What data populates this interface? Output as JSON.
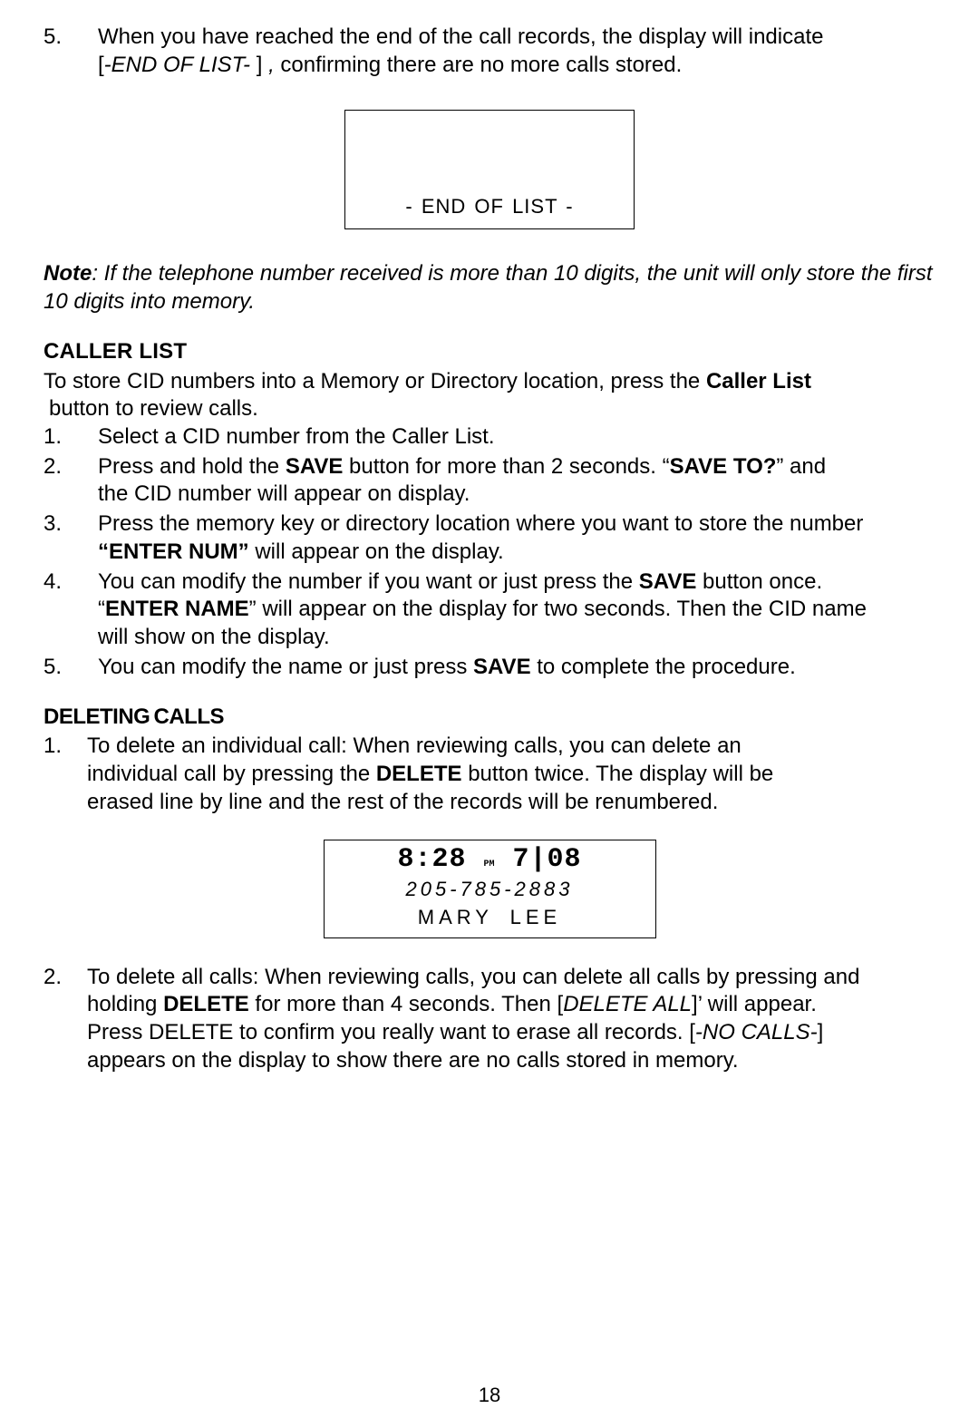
{
  "intro": {
    "num": "5.",
    "line1_a": "When you have reached the end of the call records, the display will indicate",
    "line2_b": "[",
    "line2_it": "-END OF LIST- ",
    "line2_c": "] ",
    "line2_d": ",",
    "line2_e": " confirming there are no more calls stored."
  },
  "endbox": "- END  OF  LIST -",
  "note": {
    "label": "Note",
    "text": ": If the telephone number received is more than 10 digits, the unit will only store the first 10 digits into memory."
  },
  "callerlist": {
    "heading": "CALLER LIST",
    "intro_a": "To store CID numbers into a Memory or Directory location, press the ",
    "intro_b": "Caller List",
    "intro_c": " button to review calls.",
    "items": {
      "i1": {
        "num": "1.",
        "a": "Select a CID number from the Caller List."
      },
      "i2": {
        "num": "2.",
        "a": "Press and hold the ",
        "b": "SAVE",
        "c": " button for more than 2 seconds. “",
        "d": "SAVE TO?",
        "e": "” and",
        "f": "the CID number will appear on display."
      },
      "i3": {
        "num": "3.",
        "a": "Press the memory key or directory location where you want to store the number",
        "b": "“ENTER NUM”",
        "c": " will appear on the display."
      },
      "i4": {
        "num": "4.",
        "a": "You can modify the number if you want or just press the ",
        "b": "SAVE",
        "c": " button once.",
        "d": " “",
        "e": "ENTER NAME",
        "f": "” will appear on the display for two seconds. Then the CID name",
        "g": " will show on the display."
      },
      "i5": {
        "num": "5.",
        "a": "You can modify the name or just press ",
        "b": "SAVE",
        "c": " to complete the procedure."
      }
    }
  },
  "deleting": {
    "heading": "DELETING CALLS",
    "i1": {
      "num": "1.",
      "a": "To delete an individual call:  When reviewing calls, you can delete an",
      "b": "individual call by pressing the ",
      "c": "DELETE",
      "d": " button twice. The display will be",
      "e": " erased line by line and the rest of the records will be renumbered."
    },
    "display": {
      "time": "8:28",
      "pm": "PM",
      "date": "7|08",
      "phone": "205-785-2883",
      "name": "MARY  LEE"
    },
    "i2": {
      "num": "2.",
      "a": "To delete all calls: When reviewing calls, you can delete all calls by pressing and",
      "b": " holding ",
      "c": "DELETE",
      "d": " for more than 4 seconds. Then [",
      "e": "DELETE ALL",
      "f": "]’ will appear.",
      "g": " Press DELETE to confirm you really want to erase all records. [",
      "h": "-NO CALLS-",
      "i": "]",
      "j": "appears on the display to show there are no calls stored in memory."
    }
  },
  "pagenum": "18"
}
